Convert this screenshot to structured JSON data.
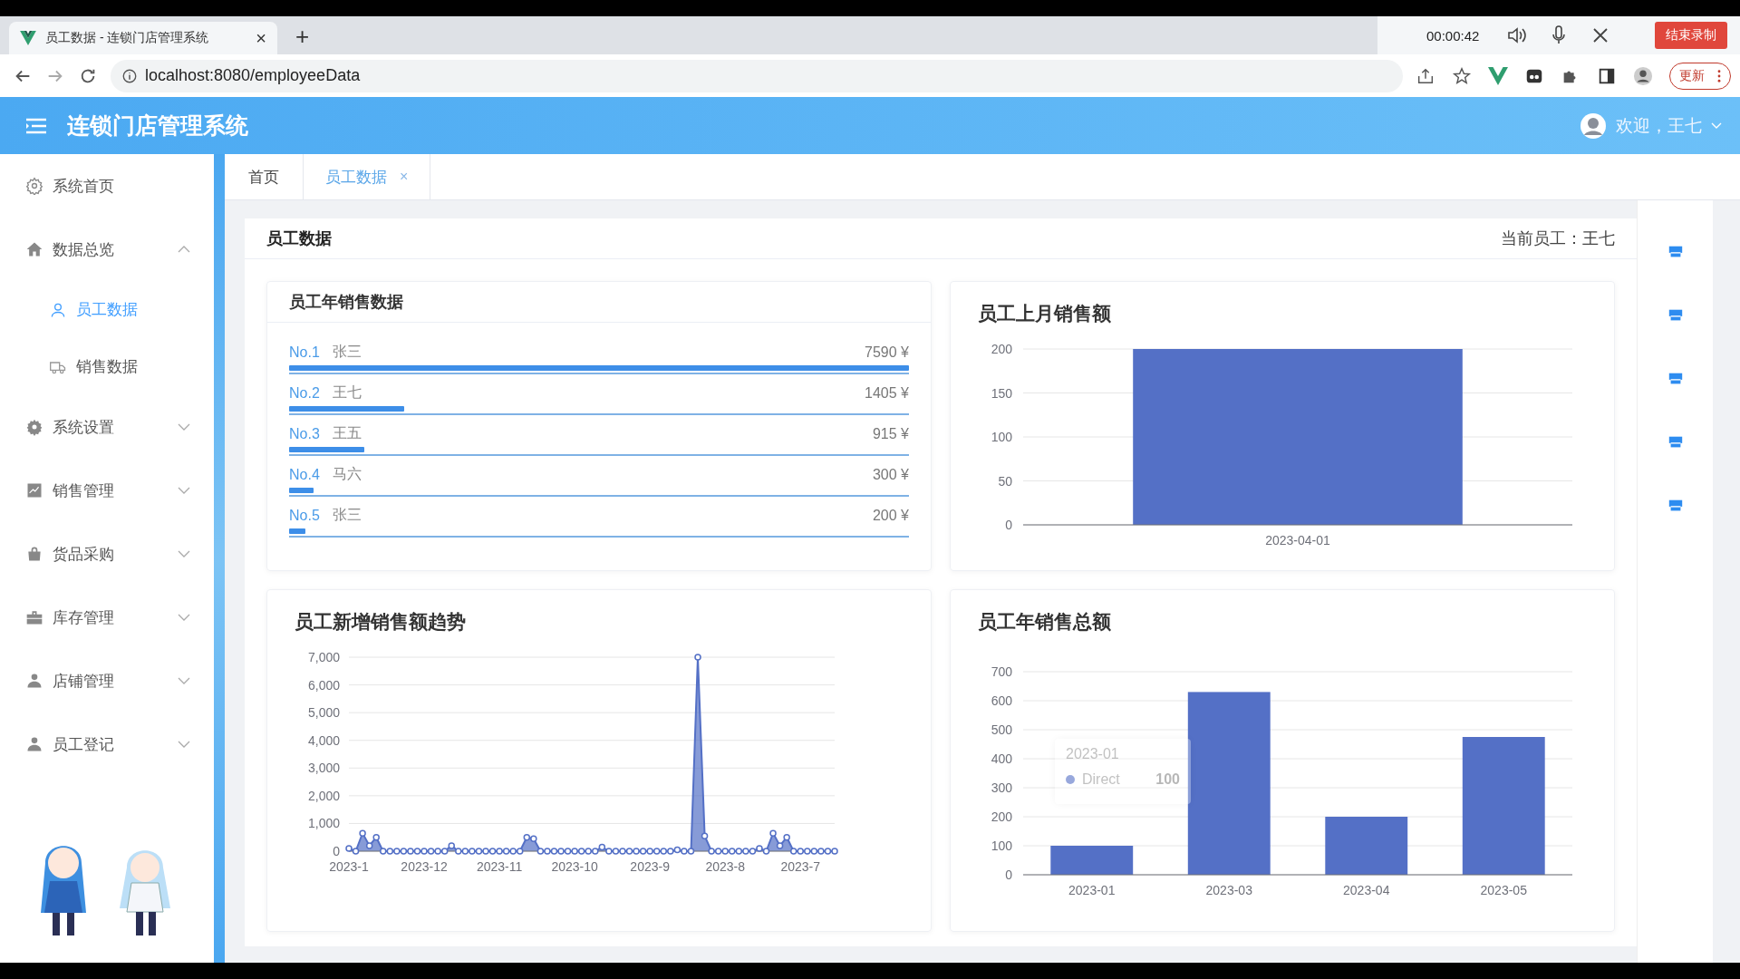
{
  "browser": {
    "tab_title": "员工数据 - 连锁门店管理系统",
    "tab_close": "×",
    "new_tab": "+",
    "url": "localhost:8080/employeeData",
    "recording_time": "00:00:42",
    "stop_recording": "结束录制",
    "update": "更新"
  },
  "header": {
    "title": "连锁门店管理系统",
    "greeting": "欢迎，王七"
  },
  "sidebar": {
    "items": [
      {
        "label": "系统首页",
        "selected": false
      },
      {
        "label": "数据总览",
        "selected": false,
        "expanded": true,
        "children": [
          {
            "label": "员工数据",
            "selected": true
          },
          {
            "label": "销售数据",
            "selected": false
          }
        ]
      },
      {
        "label": "系统设置",
        "selected": false,
        "expanded": false
      },
      {
        "label": "销售管理",
        "selected": false,
        "expanded": false
      },
      {
        "label": "货品采购",
        "selected": false,
        "expanded": false
      },
      {
        "label": "库存管理",
        "selected": false,
        "expanded": false
      },
      {
        "label": "店铺管理",
        "selected": false,
        "expanded": false
      },
      {
        "label": "员工登记",
        "selected": false,
        "expanded": false
      }
    ]
  },
  "tabs": [
    {
      "label": "首页",
      "selected": false
    },
    {
      "label": "员工数据",
      "selected": true,
      "close": "×"
    }
  ],
  "panel": {
    "title": "员工数据",
    "current_employee": "当前员工：王七"
  },
  "ranking": {
    "title": "员工年销售数据",
    "rows": [
      {
        "rank": "No.1",
        "name": "张三",
        "amount": "7590 ¥",
        "level": 1
      },
      {
        "rank": "No.2",
        "name": "王七",
        "amount": "1405 ¥",
        "level": 0.185
      },
      {
        "rank": "No.3",
        "name": "王五",
        "amount": "915 ¥",
        "level": 0.121
      },
      {
        "rank": "No.4",
        "name": "马六",
        "amount": "300 ¥",
        "level": 0.04
      },
      {
        "rank": "No.5",
        "name": "张三",
        "amount": "200 ¥",
        "level": 0.026
      }
    ]
  },
  "last_month": {
    "title": "员工上月销售额",
    "chart_data": {
      "type": "bar",
      "categories": [
        "2023-04-01"
      ],
      "values": [
        200
      ],
      "ylim": [
        0,
        200
      ],
      "yticks": [
        0,
        50,
        100,
        150,
        200
      ],
      "grid": true
    }
  },
  "trend": {
    "title": "员工新增销售额趋势",
    "chart_data": {
      "type": "area",
      "grid": true,
      "categories": [
        "2023-1",
        null,
        null,
        null,
        null,
        null,
        null,
        null,
        null,
        null,
        null,
        "2023-12",
        null,
        null,
        null,
        null,
        null,
        null,
        null,
        null,
        null,
        null,
        "2023-11",
        null,
        null,
        null,
        null,
        null,
        null,
        null,
        null,
        null,
        null,
        "2023-10",
        null,
        null,
        null,
        null,
        null,
        null,
        null,
        null,
        null,
        null,
        "2023-9",
        null,
        null,
        null,
        null,
        null,
        null,
        null,
        null,
        null,
        null,
        "2023-8",
        null,
        null,
        null,
        null,
        null,
        null,
        null,
        null,
        null,
        null,
        "2023-7",
        null,
        null,
        null,
        null,
        null
      ],
      "values": [
        100,
        0,
        650,
        200,
        500,
        0,
        0,
        0,
        0,
        0,
        0,
        0,
        0,
        0,
        0,
        200,
        0,
        0,
        0,
        0,
        0,
        0,
        0,
        0,
        0,
        0,
        500,
        450,
        0,
        0,
        0,
        0,
        0,
        0,
        0,
        0,
        0,
        150,
        0,
        0,
        0,
        0,
        0,
        0,
        0,
        0,
        0,
        0,
        50,
        0,
        0,
        7000,
        550,
        0,
        0,
        0,
        0,
        0,
        0,
        0,
        100,
        0,
        650,
        200,
        500,
        0,
        0,
        0,
        0,
        0,
        0,
        0
      ],
      "ylim": [
        0,
        7000
      ],
      "yticks": [
        {
          "value": 0,
          "label": "0"
        },
        {
          "value": 1000,
          "label": "1,000"
        },
        {
          "value": 2000,
          "label": "2,000"
        },
        {
          "value": 3000,
          "label": "3,000"
        },
        {
          "value": 4000,
          "label": "4,000"
        },
        {
          "value": 5000,
          "label": "5,000"
        },
        {
          "value": 6000,
          "label": "6,000"
        },
        {
          "value": 7000,
          "label": "7,000"
        }
      ]
    }
  },
  "annual_total": {
    "title": "员工年销售总额",
    "chart_data": {
      "type": "bar",
      "categories": [
        "2023-01",
        "2023-03",
        "2023-04",
        "2023-05"
      ],
      "series": [
        {
          "name": "Direct",
          "color": "#5470c6",
          "values": [
            100,
            630,
            200,
            475
          ]
        }
      ],
      "ylim": [
        0,
        700
      ],
      "yticks": [
        0,
        100,
        200,
        300,
        400,
        500,
        600,
        700
      ],
      "grid": true
    },
    "tooltip": {
      "title": "2023-01",
      "value": "100"
    }
  }
}
